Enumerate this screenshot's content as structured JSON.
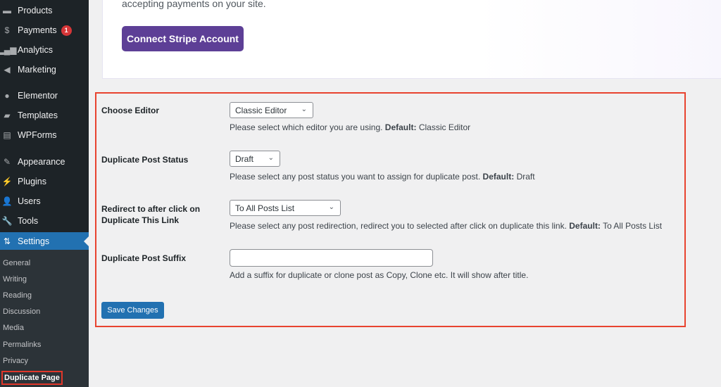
{
  "sidebar": {
    "menu": [
      {
        "label": "Products",
        "icon": "archive-icon"
      },
      {
        "label": "Payments",
        "icon": "dollar-icon",
        "badge": "1"
      },
      {
        "label": "Analytics",
        "icon": "bar-chart-icon"
      },
      {
        "label": "Marketing",
        "icon": "megaphone-icon"
      },
      {
        "label": "Elementor",
        "icon": "elementor-icon"
      },
      {
        "label": "Templates",
        "icon": "folder-icon"
      },
      {
        "label": "WPForms",
        "icon": "form-icon"
      },
      {
        "label": "Appearance",
        "icon": "paintbrush-icon"
      },
      {
        "label": "Plugins",
        "icon": "plugin-icon"
      },
      {
        "label": "Users",
        "icon": "user-icon"
      },
      {
        "label": "Tools",
        "icon": "wrench-icon"
      },
      {
        "label": "Settings",
        "icon": "settings-icon"
      }
    ],
    "submenu": [
      "General",
      "Writing",
      "Reading",
      "Discussion",
      "Media",
      "Permalinks",
      "Privacy",
      "Duplicate Page"
    ]
  },
  "stripe_card": {
    "text": "accepting payments on your site.",
    "button": "Connect Stripe Account"
  },
  "form": {
    "choose_editor": {
      "label": "Choose Editor",
      "value": "Classic Editor",
      "help": "Please select which editor you are using.",
      "default_label": "Default:",
      "default_value": "Classic Editor"
    },
    "post_status": {
      "label": "Duplicate Post Status",
      "value": "Draft",
      "help": "Please select any post status you want to assign for duplicate post.",
      "default_label": "Default:",
      "default_value": "Draft"
    },
    "redirect": {
      "label_line1": "Redirect to after click on",
      "label_line2": "Duplicate This Link",
      "value": "To All Posts List",
      "help": "Please select any post redirection, redirect you to selected after click on duplicate this link.",
      "default_label": "Default:",
      "default_value": "To All Posts List"
    },
    "suffix": {
      "label": "Duplicate Post Suffix",
      "value": "",
      "help": "Add a suffix for duplicate or clone post as Copy, Clone etc. It will show after title."
    },
    "save": "Save Changes"
  },
  "colors": {
    "accent": "#2271b1",
    "stripe": "#5d3f96",
    "highlight": "#e8432f",
    "badge": "#d63638"
  }
}
